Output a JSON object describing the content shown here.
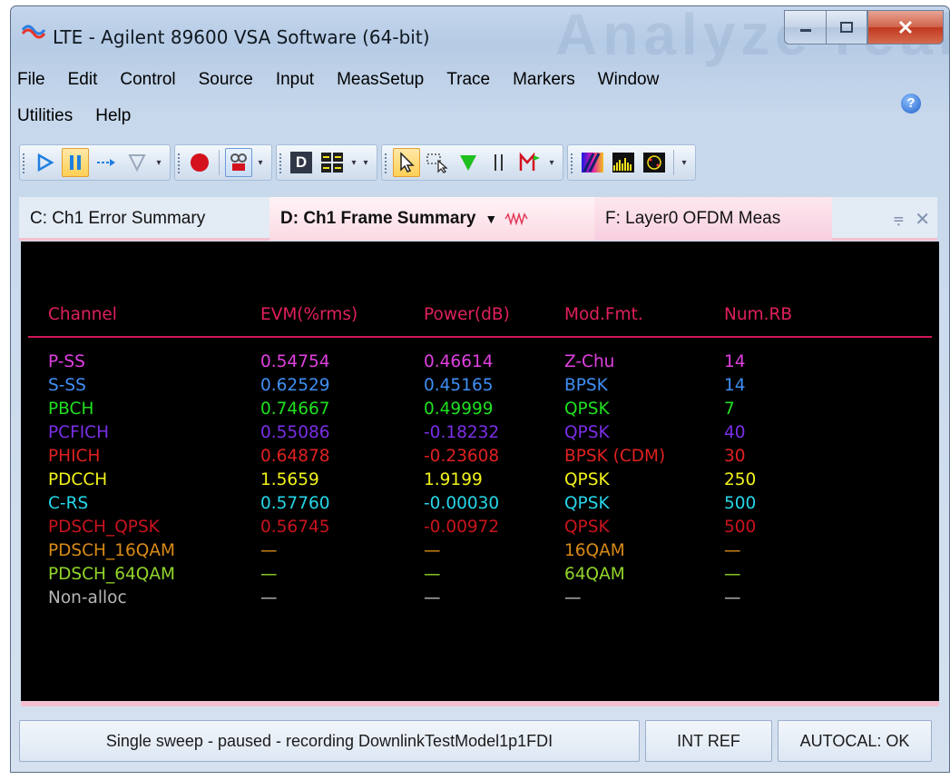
{
  "window": {
    "title": "LTE - Agilent 89600 VSA Software (64-bit)",
    "watermark": "Analyze real"
  },
  "menu": {
    "row1": [
      "File",
      "Edit",
      "Control",
      "Source",
      "Input",
      "MeasSetup",
      "Trace",
      "Markers",
      "Window"
    ],
    "row2": [
      "Utilities",
      "Help"
    ],
    "help_glyph": "?"
  },
  "toolbar": {
    "icons": [
      "play-icon",
      "pause-icon",
      "step-icon",
      "trigger-icon",
      "record-icon",
      "player-icon",
      "display-d-icon",
      "layout-grid-icon",
      "pointer-icon",
      "zoom-icon",
      "marker-triangle-icon",
      "bar-marker-icon",
      "flag-marker-icon",
      "spectrogram-icon",
      "spectrum-icon",
      "constellation-icon"
    ],
    "display_letter": "D",
    "accent_play": "#1f7fe0",
    "accent_record": "#d3121e",
    "accent_marker": "#1fbf1f"
  },
  "tabs": [
    {
      "label": "C: Ch1 Error Summary",
      "active": false
    },
    {
      "label": "D: Ch1 Frame Summary",
      "active": true
    },
    {
      "label": "F: Layer0 OFDM Meas",
      "active": false
    }
  ],
  "tab_controls": {
    "pin": "⩦",
    "close": "✕"
  },
  "table": {
    "headers": [
      "Channel",
      "EVM(%rms)",
      "Power(dB)",
      "Mod.Fmt.",
      "Num.RB"
    ],
    "rows": [
      {
        "channel": "P-SS",
        "evm": "0.54754",
        "power": "0.46614",
        "mod": "Z-Chu",
        "rb": "14",
        "color": "#e040e0"
      },
      {
        "channel": "S-SS",
        "evm": "0.62529",
        "power": "0.45165",
        "mod": "BPSK",
        "rb": "14",
        "color": "#3f8ff5"
      },
      {
        "channel": "PBCH",
        "evm": "0.74667",
        "power": "0.49999",
        "mod": "QPSK",
        "rb": "7",
        "color": "#20e020"
      },
      {
        "channel": "PCFICH",
        "evm": "0.55086",
        "power": "-0.18232",
        "mod": "QPSK",
        "rb": "40",
        "color": "#7a2fe6"
      },
      {
        "channel": "PHICH",
        "evm": "0.64878",
        "power": "-0.23608",
        "mod": "BPSK (CDM)",
        "rb": "30",
        "color": "#e02020"
      },
      {
        "channel": "PDCCH",
        "evm": "1.5659",
        "power": "1.9199",
        "mod": "QPSK",
        "rb": "250",
        "color": "#f2f21a"
      },
      {
        "channel": "C-RS",
        "evm": "0.57760",
        "power": "-0.00030",
        "mod": "QPSK",
        "rb": "500",
        "color": "#25d6e8"
      },
      {
        "channel": "PDSCH_QPSK",
        "evm": "0.56745",
        "power": "-0.00972",
        "mod": "QPSK",
        "rb": "500",
        "color": "#c8141e"
      },
      {
        "channel": "PDSCH_16QAM",
        "evm": "—",
        "power": "—",
        "mod": "16QAM",
        "rb": "—",
        "color": "#d98a16"
      },
      {
        "channel": "PDSCH_64QAM",
        "evm": "—",
        "power": "—",
        "mod": "64QAM",
        "rb": "—",
        "color": "#92d62a"
      },
      {
        "channel": "Non-alloc",
        "evm": "—",
        "power": "—",
        "mod": "—",
        "rb": "—",
        "color": "#b7b7b7"
      }
    ],
    "header_color": "#e0205a"
  },
  "status": {
    "message": "Single sweep - paused - recording DownlinkTestModel1p1FDI",
    "ref": "INT REF",
    "autocal": "AUTOCAL: OK"
  }
}
